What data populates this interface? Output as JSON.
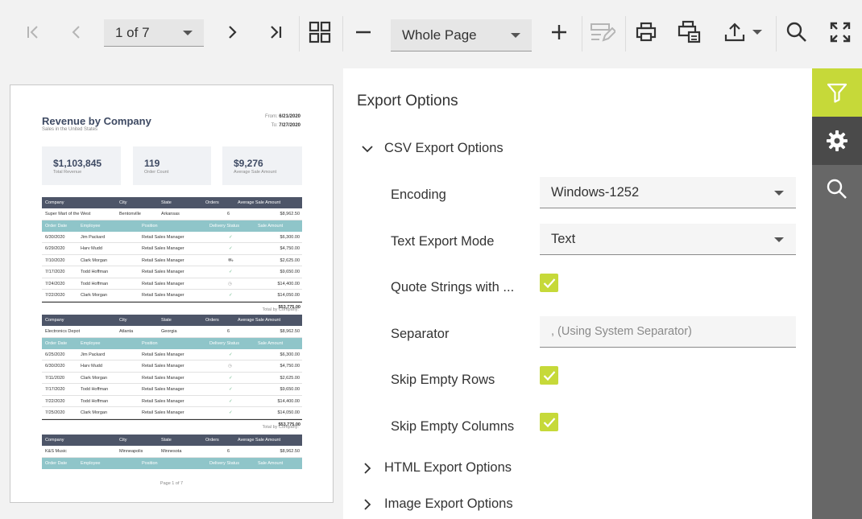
{
  "toolbar": {
    "page_selector": "1 of 7",
    "zoom_selector": "Whole Page",
    "icons": [
      "first-page-icon",
      "previous-page-icon",
      "next-page-icon",
      "last-page-icon",
      "multipage-icon",
      "zoom-out-icon",
      "zoom-in-icon",
      "editing-fields-icon",
      "print-icon",
      "print-page-icon",
      "export-icon",
      "search-icon",
      "fullscreen-icon"
    ]
  },
  "report": {
    "title": "Revenue by Company",
    "subtitle": "Sales in the United States",
    "from_label": "From:",
    "from_value": "6/21/2020",
    "to_label": "To:",
    "to_value": "7/27/2020",
    "kpis": [
      {
        "value": "$1,103,845",
        "label": "Total Revenue"
      },
      {
        "value": "119",
        "label": "Order Count"
      },
      {
        "value": "$9,276",
        "label": "Average Sale Amount"
      }
    ],
    "company_headers": [
      "Company",
      "City",
      "State",
      "Orders",
      "Average Sale Amount"
    ],
    "order_headers": [
      "Order Date",
      "Employee",
      "Position",
      "Delivery Status",
      "Sale Amount"
    ],
    "groups": [
      {
        "company": [
          "Super Mart of the West",
          "Bentonville",
          "Arkansas",
          "6",
          "$8,962.50"
        ],
        "orders": [
          [
            "6/30/2020",
            "Jim Packard",
            "Retail Sales Manager",
            "check",
            "$6,300.00"
          ],
          [
            "6/29/2020",
            "Harv Mudd",
            "Retail Sales Manager",
            "check",
            "$4,750.00"
          ],
          [
            "7/10/2020",
            "Clark Morgan",
            "Retail Sales Manager",
            "truck",
            "$2,625.00"
          ],
          [
            "7/17/2020",
            "Todd Hoffman",
            "Retail Sales Manager",
            "check",
            "$9,650.00"
          ],
          [
            "7/24/2020",
            "Todd Hoffman",
            "Retail Sales Manager",
            "clock",
            "$14,400.00"
          ],
          [
            "7/22/2020",
            "Clark Morgan",
            "Retail Sales Manager",
            "check",
            "$14,050.00"
          ]
        ],
        "total_label": "Total by Company:",
        "total_value": "$53,775.00"
      },
      {
        "company": [
          "Electronics Depot",
          "Atlanta",
          "Georgia",
          "6",
          "$8,962.50"
        ],
        "orders": [
          [
            "6/25/2020",
            "Jim Packard",
            "Retail Sales Manager",
            "check",
            "$6,300.00"
          ],
          [
            "6/30/2020",
            "Harv Mudd",
            "Retail Sales Manager",
            "clock",
            "$4,750.00"
          ],
          [
            "7/11/2020",
            "Clark Morgan",
            "Retail Sales Manager",
            "check",
            "$2,625.00"
          ],
          [
            "7/17/2020",
            "Todd Hoffman",
            "Retail Sales Manager",
            "check",
            "$9,650.00"
          ],
          [
            "7/22/2020",
            "Todd Hoffman",
            "Retail Sales Manager",
            "check",
            "$14,400.00"
          ],
          [
            "7/25/2020",
            "Clark Morgan",
            "Retail Sales Manager",
            "check",
            "$14,050.00"
          ]
        ],
        "total_label": "Total by Company:",
        "total_value": "$53,775.00"
      },
      {
        "company": [
          "K&S Music",
          "Minneapolis",
          "Minnesota",
          "6",
          "$8,962.50"
        ],
        "orders": [],
        "total_label": "",
        "total_value": ""
      }
    ],
    "page_footer": "Page 1 of 7"
  },
  "panel": {
    "title": "Export Options",
    "csv_section": "CSV Export Options",
    "encoding_label": "Encoding",
    "encoding_value": "Windows-1252",
    "text_mode_label": "Text Export Mode",
    "text_mode_value": "Text",
    "quote_label": "Quote Strings with ...",
    "separator_label": "Separator",
    "separator_placeholder": ", (Using System Separator)",
    "skip_rows_label": "Skip Empty Rows",
    "skip_cols_label": "Skip Empty Columns",
    "html_section": "HTML Export Options",
    "image_section": "Image Export Options"
  },
  "sidebar": {
    "tabs": [
      "filter-icon",
      "gear-icon",
      "search-icon"
    ]
  },
  "colors": {
    "accent": "#c6d939",
    "sidebar_bg": "#676767",
    "report_dark": "#4d5568",
    "report_teal": "#8fc5c9"
  }
}
